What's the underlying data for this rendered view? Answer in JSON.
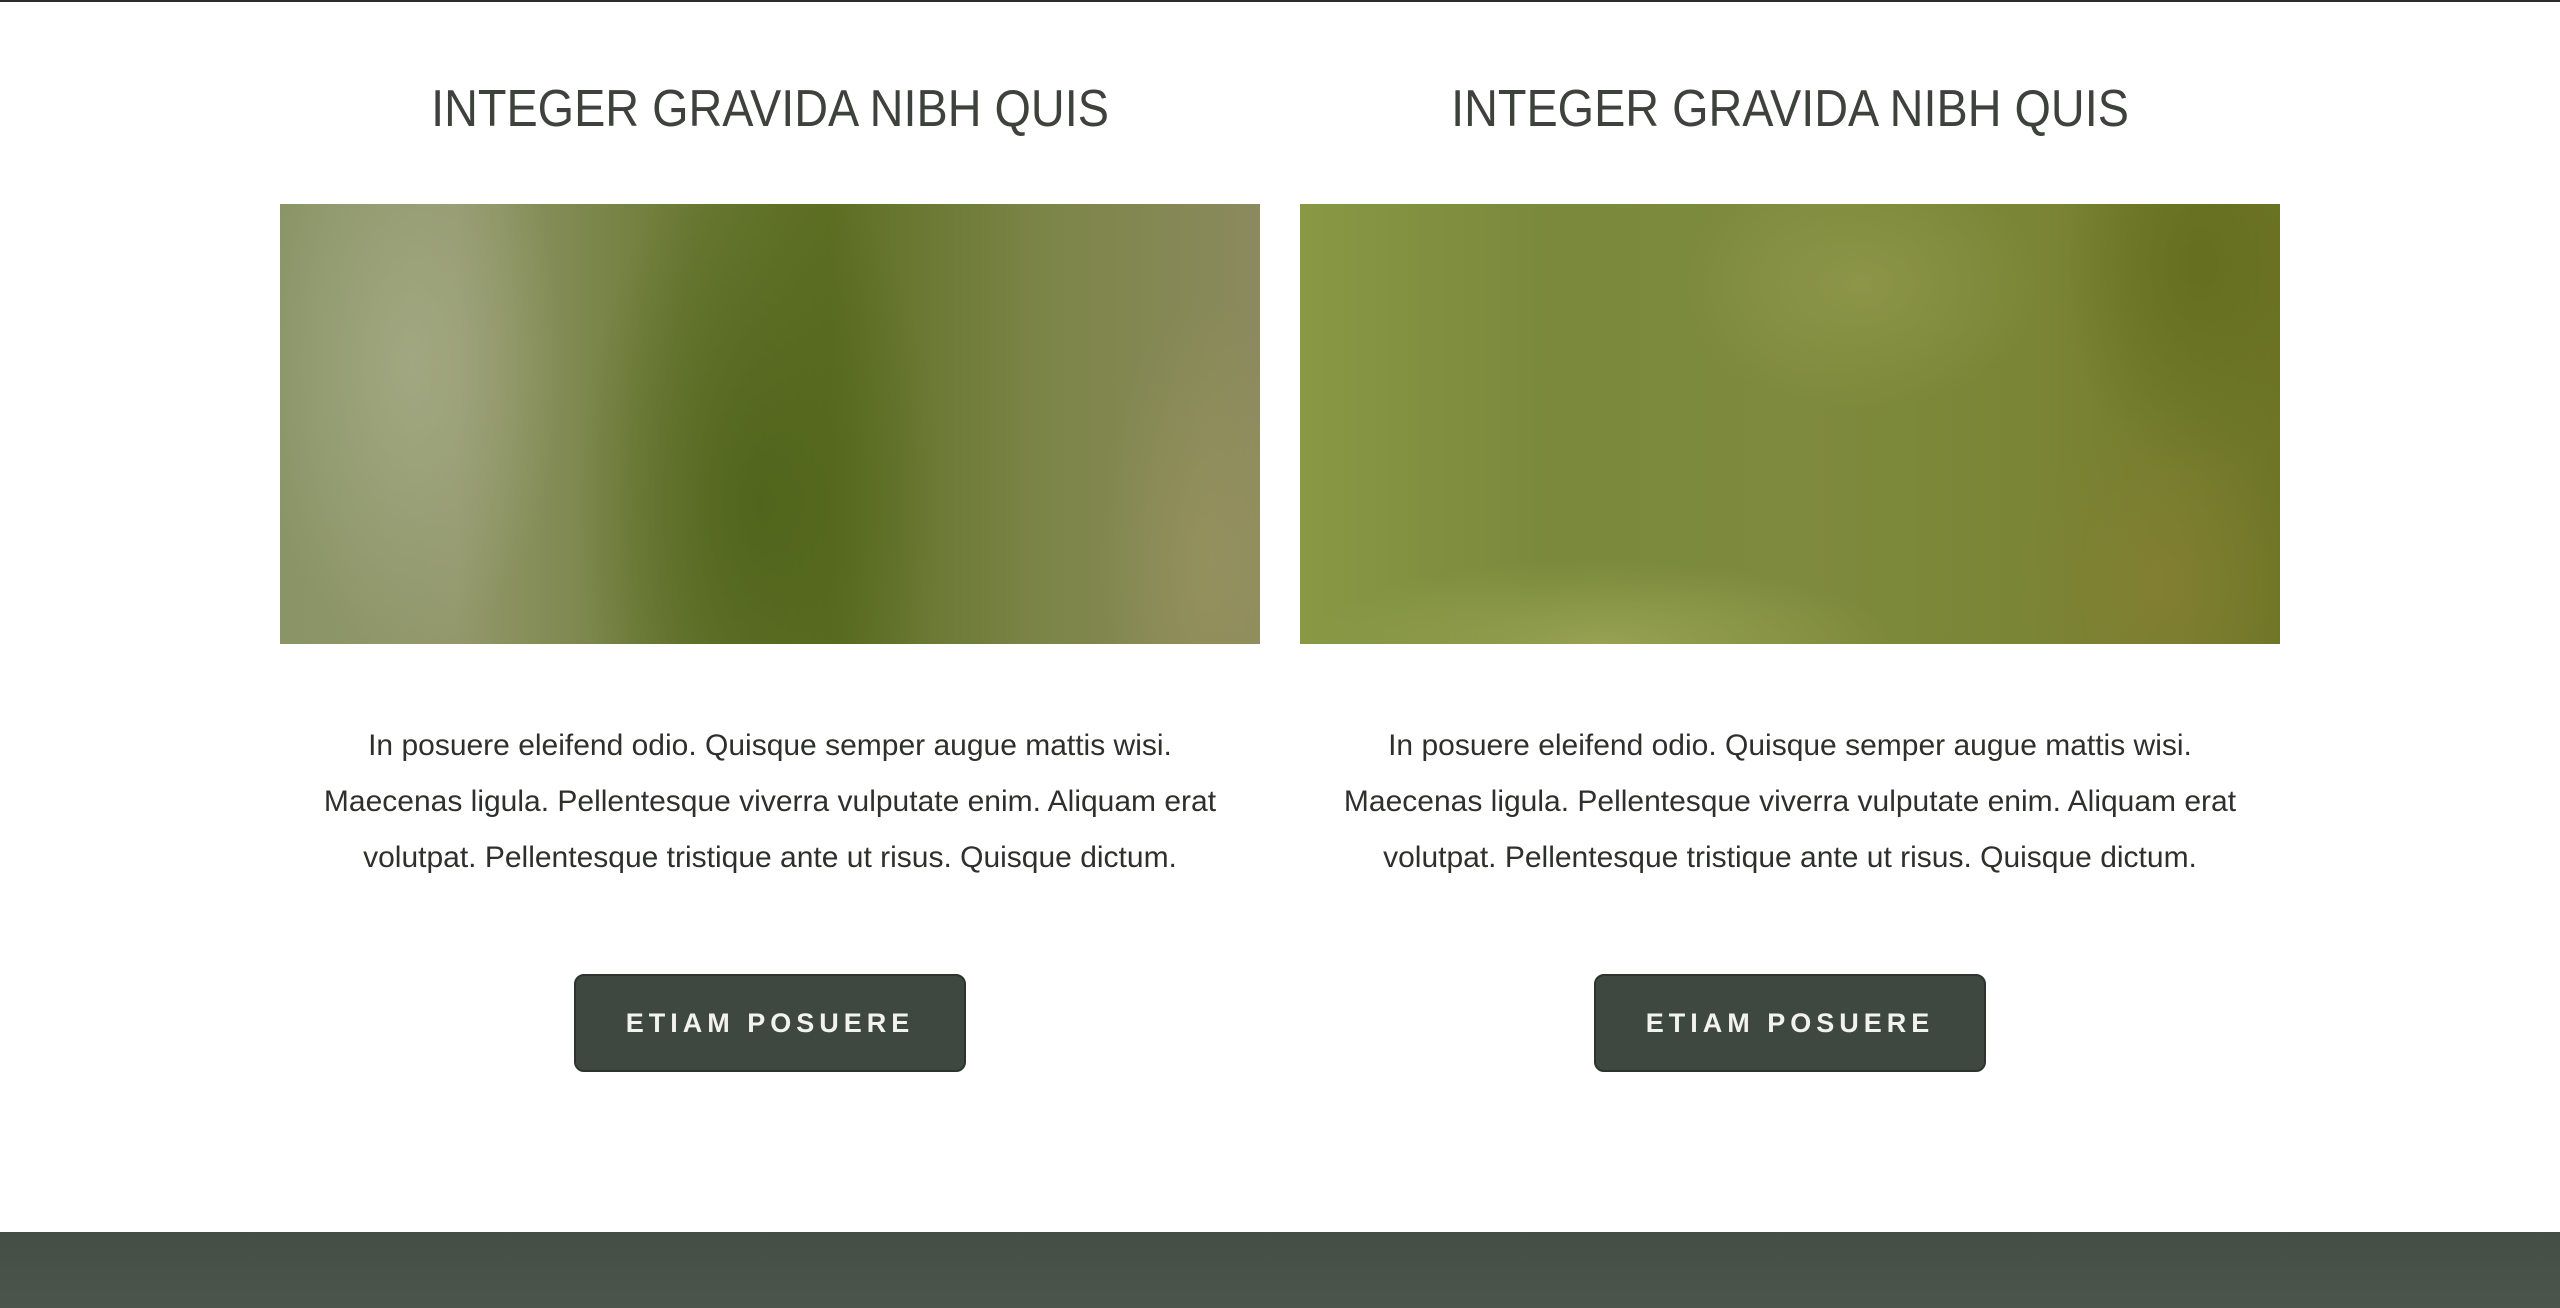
{
  "columns": [
    {
      "title": "INTEGER GRAVIDA NIBH QUIS",
      "image_alt": "green blurred nature image",
      "body": "In posuere eleifend odio. Quisque semper augue mattis wisi. Maecenas ligula. Pellentesque viverra vulputate enim. Aliquam erat volutpat. Pellentesque tristique ante ut risus. Quisque dictum.",
      "button_label": "ETIAM POSUERE"
    },
    {
      "title": "INTEGER GRAVIDA NIBH QUIS",
      "image_alt": "green blurred nature image",
      "body": "In posuere eleifend odio. Quisque semper augue mattis wisi. Maecenas ligula. Pellentesque viverra vulputate enim. Aliquam erat volutpat. Pellentesque tristique ante ut risus. Quisque dictum.",
      "button_label": "ETIAM POSUERE"
    }
  ],
  "colors": {
    "button_bg": "#3f4840",
    "footer_bg": "#4a5349",
    "heading": "#3e423c",
    "body_text": "#2e302c"
  }
}
